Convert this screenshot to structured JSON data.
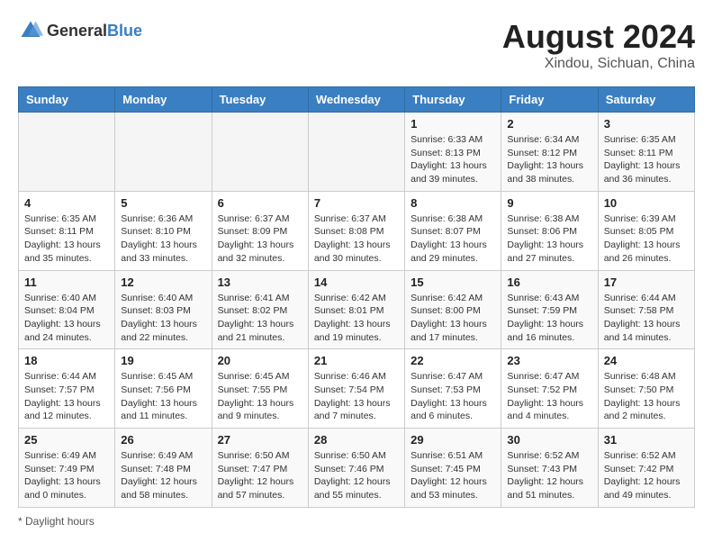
{
  "header": {
    "logo_general": "General",
    "logo_blue": "Blue",
    "month_year": "August 2024",
    "location": "Xindou, Sichuan, China"
  },
  "weekdays": [
    "Sunday",
    "Monday",
    "Tuesday",
    "Wednesday",
    "Thursday",
    "Friday",
    "Saturday"
  ],
  "weeks": [
    [
      {
        "day": "",
        "info": ""
      },
      {
        "day": "",
        "info": ""
      },
      {
        "day": "",
        "info": ""
      },
      {
        "day": "",
        "info": ""
      },
      {
        "day": "1",
        "info": "Sunrise: 6:33 AM\nSunset: 8:13 PM\nDaylight: 13 hours\nand 39 minutes."
      },
      {
        "day": "2",
        "info": "Sunrise: 6:34 AM\nSunset: 8:12 PM\nDaylight: 13 hours\nand 38 minutes."
      },
      {
        "day": "3",
        "info": "Sunrise: 6:35 AM\nSunset: 8:11 PM\nDaylight: 13 hours\nand 36 minutes."
      }
    ],
    [
      {
        "day": "4",
        "info": "Sunrise: 6:35 AM\nSunset: 8:11 PM\nDaylight: 13 hours\nand 35 minutes."
      },
      {
        "day": "5",
        "info": "Sunrise: 6:36 AM\nSunset: 8:10 PM\nDaylight: 13 hours\nand 33 minutes."
      },
      {
        "day": "6",
        "info": "Sunrise: 6:37 AM\nSunset: 8:09 PM\nDaylight: 13 hours\nand 32 minutes."
      },
      {
        "day": "7",
        "info": "Sunrise: 6:37 AM\nSunset: 8:08 PM\nDaylight: 13 hours\nand 30 minutes."
      },
      {
        "day": "8",
        "info": "Sunrise: 6:38 AM\nSunset: 8:07 PM\nDaylight: 13 hours\nand 29 minutes."
      },
      {
        "day": "9",
        "info": "Sunrise: 6:38 AM\nSunset: 8:06 PM\nDaylight: 13 hours\nand 27 minutes."
      },
      {
        "day": "10",
        "info": "Sunrise: 6:39 AM\nSunset: 8:05 PM\nDaylight: 13 hours\nand 26 minutes."
      }
    ],
    [
      {
        "day": "11",
        "info": "Sunrise: 6:40 AM\nSunset: 8:04 PM\nDaylight: 13 hours\nand 24 minutes."
      },
      {
        "day": "12",
        "info": "Sunrise: 6:40 AM\nSunset: 8:03 PM\nDaylight: 13 hours\nand 22 minutes."
      },
      {
        "day": "13",
        "info": "Sunrise: 6:41 AM\nSunset: 8:02 PM\nDaylight: 13 hours\nand 21 minutes."
      },
      {
        "day": "14",
        "info": "Sunrise: 6:42 AM\nSunset: 8:01 PM\nDaylight: 13 hours\nand 19 minutes."
      },
      {
        "day": "15",
        "info": "Sunrise: 6:42 AM\nSunset: 8:00 PM\nDaylight: 13 hours\nand 17 minutes."
      },
      {
        "day": "16",
        "info": "Sunrise: 6:43 AM\nSunset: 7:59 PM\nDaylight: 13 hours\nand 16 minutes."
      },
      {
        "day": "17",
        "info": "Sunrise: 6:44 AM\nSunset: 7:58 PM\nDaylight: 13 hours\nand 14 minutes."
      }
    ],
    [
      {
        "day": "18",
        "info": "Sunrise: 6:44 AM\nSunset: 7:57 PM\nDaylight: 13 hours\nand 12 minutes."
      },
      {
        "day": "19",
        "info": "Sunrise: 6:45 AM\nSunset: 7:56 PM\nDaylight: 13 hours\nand 11 minutes."
      },
      {
        "day": "20",
        "info": "Sunrise: 6:45 AM\nSunset: 7:55 PM\nDaylight: 13 hours\nand 9 minutes."
      },
      {
        "day": "21",
        "info": "Sunrise: 6:46 AM\nSunset: 7:54 PM\nDaylight: 13 hours\nand 7 minutes."
      },
      {
        "day": "22",
        "info": "Sunrise: 6:47 AM\nSunset: 7:53 PM\nDaylight: 13 hours\nand 6 minutes."
      },
      {
        "day": "23",
        "info": "Sunrise: 6:47 AM\nSunset: 7:52 PM\nDaylight: 13 hours\nand 4 minutes."
      },
      {
        "day": "24",
        "info": "Sunrise: 6:48 AM\nSunset: 7:50 PM\nDaylight: 13 hours\nand 2 minutes."
      }
    ],
    [
      {
        "day": "25",
        "info": "Sunrise: 6:49 AM\nSunset: 7:49 PM\nDaylight: 13 hours\nand 0 minutes."
      },
      {
        "day": "26",
        "info": "Sunrise: 6:49 AM\nSunset: 7:48 PM\nDaylight: 12 hours\nand 58 minutes."
      },
      {
        "day": "27",
        "info": "Sunrise: 6:50 AM\nSunset: 7:47 PM\nDaylight: 12 hours\nand 57 minutes."
      },
      {
        "day": "28",
        "info": "Sunrise: 6:50 AM\nSunset: 7:46 PM\nDaylight: 12 hours\nand 55 minutes."
      },
      {
        "day": "29",
        "info": "Sunrise: 6:51 AM\nSunset: 7:45 PM\nDaylight: 12 hours\nand 53 minutes."
      },
      {
        "day": "30",
        "info": "Sunrise: 6:52 AM\nSunset: 7:43 PM\nDaylight: 12 hours\nand 51 minutes."
      },
      {
        "day": "31",
        "info": "Sunrise: 6:52 AM\nSunset: 7:42 PM\nDaylight: 12 hours\nand 49 minutes."
      }
    ]
  ],
  "footer": {
    "note": "Daylight hours"
  }
}
